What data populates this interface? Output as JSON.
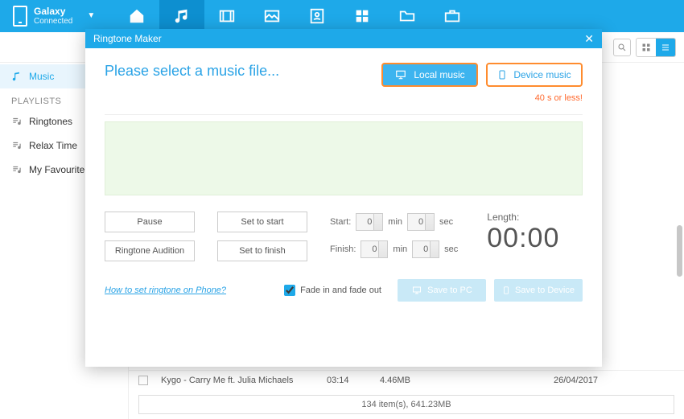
{
  "device": {
    "name": "Galaxy",
    "status": "Connected"
  },
  "sidebar": {
    "music": "Music",
    "section": "PLAYLISTS",
    "items": [
      "Ringtones",
      "Relax Time",
      "My Favourite"
    ]
  },
  "track": {
    "title": "Kygo - Carry Me ft. Julia Michaels",
    "duration": "03:14",
    "size": "4.46MB",
    "date": "26/04/2017"
  },
  "statusbar": "134 item(s), 641.23MB",
  "modal": {
    "title": "Ringtone Maker",
    "headline": "Please select a music file...",
    "local": "Local music",
    "device": "Device music",
    "limit": "40 s or less!",
    "pause": "Pause",
    "setStart": "Set to start",
    "audition": "Ringtone Audition",
    "setFinish": "Set to finish",
    "startLabel": "Start:",
    "finishLabel": "Finish:",
    "min": "min",
    "sec": "sec",
    "startMin": "0",
    "startSec": "0",
    "finishMin": "0",
    "finishSec": "0",
    "lengthLabel": "Length:",
    "lengthValue": "00:00",
    "help": "How to set ringtone on Phone?",
    "fade": "Fade in and fade out",
    "savePC": "Save to PC",
    "saveDevice": "Save to Device"
  }
}
